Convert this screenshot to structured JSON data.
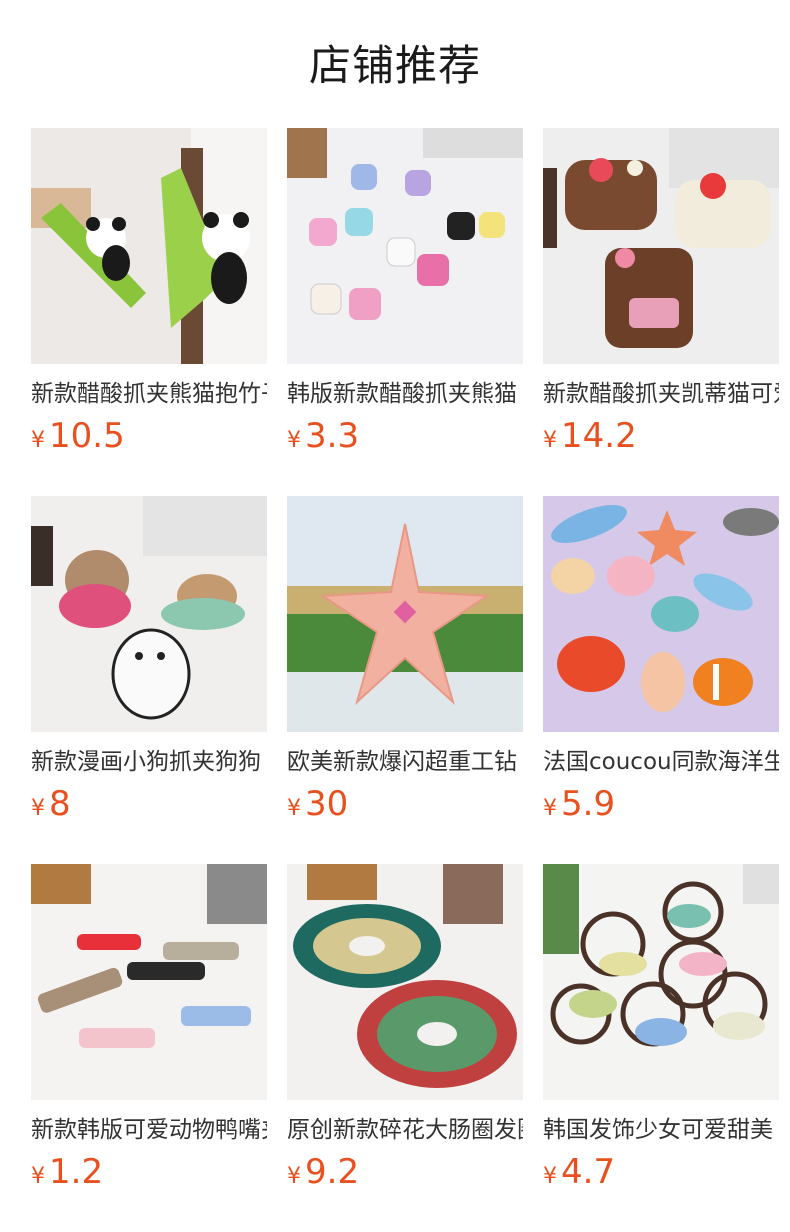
{
  "section": {
    "title": "店铺推荐"
  },
  "currency_symbol": "¥",
  "colors": {
    "price": "#e8501f",
    "name": "#333333",
    "title": "#1a1a1a"
  },
  "products": [
    {
      "name": "新款醋酸抓夹熊猫抱竹子",
      "price": "10.5",
      "image": "panda-bamboo-clips"
    },
    {
      "name": "韩版新款醋酸抓夹熊猫",
      "price": "3.3",
      "image": "mini-panda-clips"
    },
    {
      "name": "新款醋酸抓夹凯蒂猫可爱",
      "price": "14.2",
      "image": "kitty-claw-clips"
    },
    {
      "name": "新款漫画小狗抓夹狗狗",
      "price": "8",
      "image": "cartoon-dog-clips"
    },
    {
      "name": "欧美新款爆闪超重工钻",
      "price": "30",
      "image": "rhinestone-starfish-clip"
    },
    {
      "name": "法国coucou同款海洋生物",
      "price": "5.9",
      "image": "ocean-creature-clips"
    },
    {
      "name": "新款韩版可爱动物鸭嘴夹",
      "price": "1.2",
      "image": "cat-duckbill-clips"
    },
    {
      "name": "原创新款碎花大肠圈发圈",
      "price": "9.2",
      "image": "floral-scrunchies"
    },
    {
      "name": "韩国发饰少女可爱甜美",
      "price": "4.7",
      "image": "bow-hair-ties"
    }
  ]
}
